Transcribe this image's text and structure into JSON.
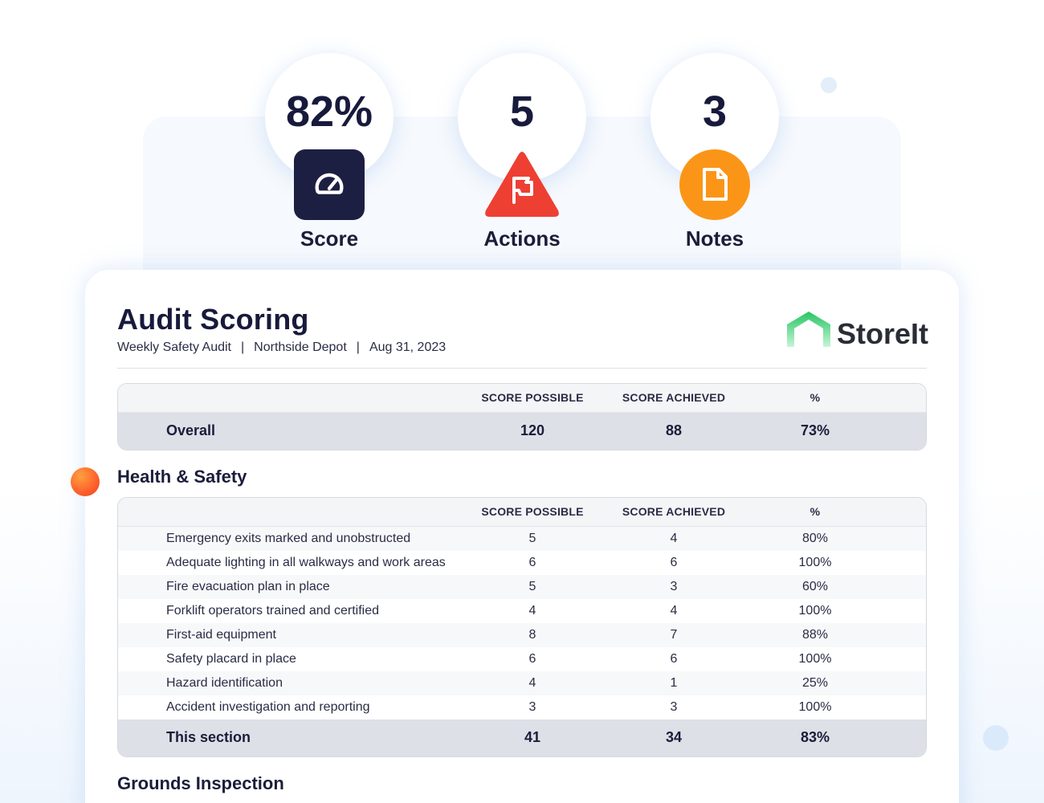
{
  "stats": [
    {
      "value": "82%",
      "label": "Score",
      "icon": "speedometer-icon",
      "color": "#1d1f42"
    },
    {
      "value": "5",
      "label": "Actions",
      "icon": "flag-icon",
      "color": "#ee3f33"
    },
    {
      "value": "3",
      "label": "Notes",
      "icon": "document-icon",
      "color": "#fb9517"
    }
  ],
  "report": {
    "title": "Audit Scoring",
    "template": "Weekly Safety Audit",
    "site": "Northside Depot",
    "date": "Aug 31, 2023",
    "separator": "|",
    "logo_text": "StoreIt",
    "logo_color": "#2fce6c"
  },
  "columns": {
    "possible": "SCORE POSSIBLE",
    "achieved": "SCORE ACHIEVED",
    "percent": "%"
  },
  "overall": {
    "label": "Overall",
    "possible": "120",
    "achieved": "88",
    "percent": "73%"
  },
  "sections": [
    {
      "title": "Health & Safety",
      "items": [
        {
          "name": "Emergency exits marked and unobstructed",
          "possible": "5",
          "achieved": "4",
          "percent": "80%"
        },
        {
          "name": "Adequate lighting in all walkways and work areas",
          "possible": "6",
          "achieved": "6",
          "percent": "100%"
        },
        {
          "name": "Fire evacuation plan in place",
          "possible": "5",
          "achieved": "3",
          "percent": "60%"
        },
        {
          "name": "Forklift operators trained and certified",
          "possible": "4",
          "achieved": "4",
          "percent": "100%"
        },
        {
          "name": "First-aid equipment",
          "possible": "8",
          "achieved": "7",
          "percent": "88%"
        },
        {
          "name": "Safety placard in place",
          "possible": "6",
          "achieved": "6",
          "percent": "100%"
        },
        {
          "name": "Hazard identification",
          "possible": "4",
          "achieved": "1",
          "percent": "25%"
        },
        {
          "name": "Accident investigation and reporting",
          "possible": "3",
          "achieved": "3",
          "percent": "100%"
        }
      ],
      "total": {
        "label": "This section",
        "possible": "41",
        "achieved": "34",
        "percent": "83%"
      }
    },
    {
      "title": "Grounds Inspection"
    }
  ]
}
